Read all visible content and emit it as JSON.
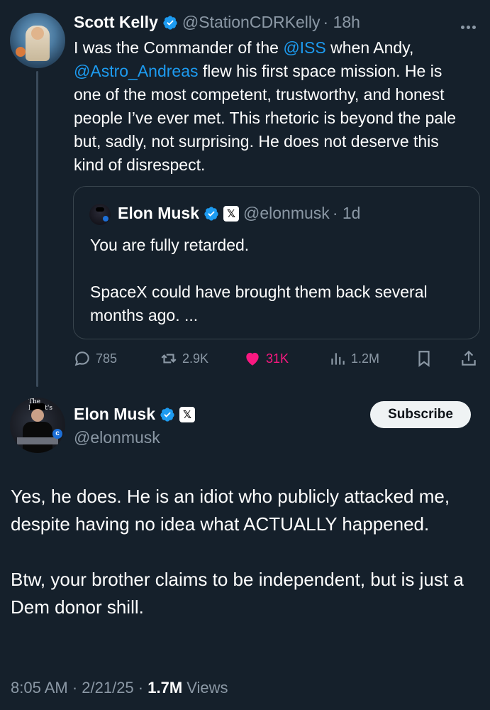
{
  "reply_tweet": {
    "author_name": "Scott Kelly",
    "author_handle": "@StationCDRKelly",
    "time": "· 18h",
    "text_parts": {
      "t1": "I was the Commander of the ",
      "m1": "@ISS",
      "t2": " when Andy,",
      "m2": "@Astro_Andreas",
      "t3": " flew his first space mission. He is one of the most competent, trustworthy, and honest people I’ve ever met. This rhetoric is beyond the pale but, sadly, not surprising. He does not deserve this kind of disrespect."
    },
    "more_icon": "more-horizontal-icon",
    "quote": {
      "author_name": "Elon Musk",
      "author_handle": "@elonmusk",
      "time": "· 1d",
      "text": "You are fully retarded.\n\nSpaceX could have brought them back several months ago. ..."
    },
    "actions": {
      "replies": "785",
      "reposts": "2.9K",
      "likes": "31K",
      "views": "1.2M"
    }
  },
  "main_tweet": {
    "author_name": "Elon Musk",
    "author_handle": "@elonmusk",
    "subscribe_label": "Subscribe",
    "avatar_tag": "The Roget's",
    "avatar_badge": "c",
    "paragraphs": [
      "Yes, he does. He is an idiot who publicly attacked me, despite having no idea what ACTUALLY happened.",
      "Btw, your brother claims to be independent, but is just a Dem donor shill."
    ],
    "meta": {
      "time": "8:05 AM · 2/21/25 · ",
      "views_count": "1.7M",
      "views_label": " Views"
    }
  },
  "colors": {
    "background": "#15202b",
    "mention": "#1d9bf0",
    "muted": "#8b98a5",
    "like": "#f91880",
    "verified": "#1d9bf0"
  }
}
